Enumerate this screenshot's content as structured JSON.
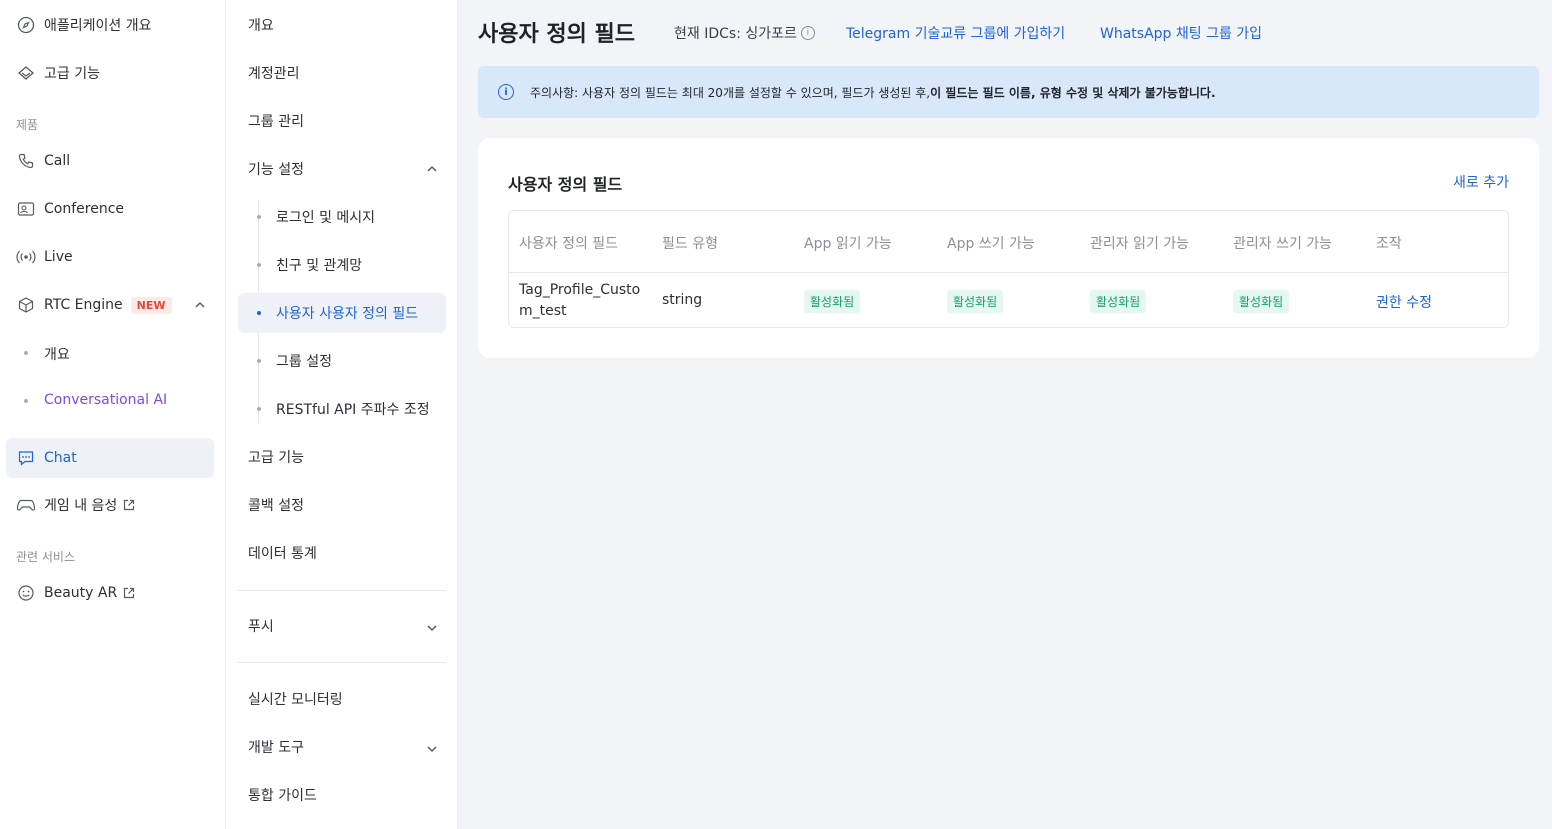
{
  "sidebar1": {
    "overview": "애플리케이션 개요",
    "advanced": "고급 기능",
    "section_products": "제품",
    "call": "Call",
    "conference": "Conference",
    "live": "Live",
    "rtc_engine": "RTC Engine",
    "new_badge": "NEW",
    "rtc_overview": "개요",
    "conversational_ai": "Conversational AI",
    "chat": "Chat",
    "game_voice": "게임 내 음성",
    "section_related": "관련 서비스",
    "beauty_ar": "Beauty AR"
  },
  "sidebar2": {
    "overview": "개요",
    "account": "계정관리",
    "group_manage": "그룹 관리",
    "feature_settings": "기능 설정",
    "sub_login": "로그인 및 메시지",
    "sub_friends": "친구 및 관계망",
    "sub_custom_fields": "사용자 사용자 정의 필드",
    "sub_group_settings": "그룹 설정",
    "sub_restful": "RESTful API 주파수 조정",
    "advanced": "고급 기능",
    "callback": "콜백 설정",
    "data_stats": "데이터 통계",
    "push": "푸시",
    "realtime": "실시간 모니터링",
    "dev_tools": "개발 도구",
    "integration": "통합 가이드"
  },
  "header": {
    "title": "사용자 정의 필드",
    "idc_label": "현재 IDCs: 싱가포르",
    "telegram": "Telegram 기술교류 그룹에 가입하기",
    "whatsapp": "WhatsApp 채팅 그룹 가입"
  },
  "notice": {
    "text": "주의사항: 사용자 정의 필드는 최대 20개를 설정할 수 있으며, 필드가 생성된 후, ",
    "bold": "이 필드는 필드 이름, 유형 수정 및 삭제가 불가능합니다."
  },
  "card": {
    "title": "사용자 정의 필드",
    "add": "새로 추가",
    "columns": [
      "사용자 정의 필드",
      "필드 유형",
      "App 읽기 가능",
      "App 쓰기 가능",
      "관리자 읽기 가능",
      "관리자 쓰기 가능",
      "조작"
    ],
    "rows": [
      {
        "field": "Tag_Profile_Custom_test",
        "type": "string",
        "app_read": "활성화됨",
        "app_write": "활성화됨",
        "admin_read": "활성화됨",
        "admin_write": "활성화됨",
        "action": "권한 수정"
      }
    ]
  }
}
